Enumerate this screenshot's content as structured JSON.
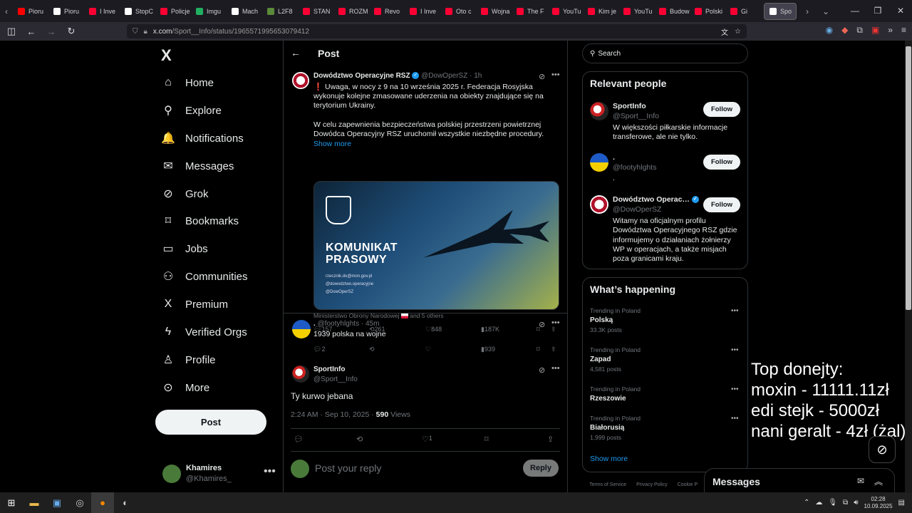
{
  "browser": {
    "tabs": [
      "Pioru",
      "Pioru",
      "I Inve",
      "StopC",
      "Policje",
      "Imgu",
      "Mach",
      "L2F8",
      "STAN",
      "ROZM",
      "Revo",
      "I Inve",
      "Oto c",
      "Wojna",
      "The F",
      "YouTu",
      "Kim je",
      "YouTu",
      "Budow",
      "Polski",
      "Gi",
      "Spo"
    ],
    "tab_colors": [
      "#ff0000",
      "#ffffff",
      "#ff0033",
      "#ffffff",
      "#ff0033",
      "#20b060",
      "#ffffff",
      "#5a8a3a",
      "#ff0033",
      "#ff0033",
      "#ff0033",
      "#ff0033",
      "#ff0033",
      "#ff0033",
      "#ff0033",
      "#ff0033",
      "#ff0033",
      "#ff0033",
      "#ff0033",
      "#ff0033",
      "#ff0033",
      "#ffffff"
    ],
    "url_host": "x.com",
    "url_path": "/Sport__Info/status/1965571995653079412"
  },
  "nav": {
    "logo": "X",
    "items": [
      {
        "label": "Home",
        "icon": "⌂"
      },
      {
        "label": "Explore",
        "icon": "⚲"
      },
      {
        "label": "Notifications",
        "icon": "🔔"
      },
      {
        "label": "Messages",
        "icon": "✉"
      },
      {
        "label": "Grok",
        "icon": "⊘"
      },
      {
        "label": "Bookmarks",
        "icon": "⌑"
      },
      {
        "label": "Jobs",
        "icon": "▭"
      },
      {
        "label": "Communities",
        "icon": "⚇"
      },
      {
        "label": "Premium",
        "icon": "X"
      },
      {
        "label": "Verified Orgs",
        "icon": "ϟ"
      },
      {
        "label": "Profile",
        "icon": "♙"
      },
      {
        "label": "More",
        "icon": "⊙"
      }
    ],
    "post_button": "Post",
    "account": {
      "name": "Khamires",
      "handle": "@Khamires_"
    }
  },
  "header": {
    "title": "Post"
  },
  "quoted_tweet": {
    "name": "Dowództwo Operacyjne RSZ",
    "handle": "@DowOperSZ",
    "time": "· 1h",
    "text1": "❗ Uwaga, w nocy z 9 na 10 września 2025 r. Federacja Rosyjska wykonuje kolejne zmasowane uderzenia na obiekty znajdujące się na terytorium Ukrainy.",
    "text2": "W celu zapewnienia bezpieczeństwa polskiej przestrzeni powietrznej Dowódca Operacyjny RSZ uruchomił wszystkie niezbędne procedury.",
    "show_more": "Show more",
    "image": {
      "title_line1": "KOMUNIKAT",
      "title_line2": "PRASOWY",
      "contact1": "rzecznik.do@mon.gov.pl",
      "contact2": "@dowodztwo.operacyjne",
      "contact3": "@DowOperSZ"
    },
    "tagged": "Ministerstwo Obrony Narodowej",
    "tagged_more": "and 5 others",
    "replies": "157",
    "reposts": "261",
    "likes": "848",
    "views": "187K"
  },
  "reply1": {
    "name": ".",
    "handle": "@footyhlghts",
    "time": "· 45m",
    "text": "1939 polska na wojne",
    "replies": "2",
    "views": "939"
  },
  "main_tweet": {
    "name": "SportInfo",
    "handle": "@Sport__Info",
    "text": "Ty kurwo jebana",
    "timestamp": "2:24 AM · Sep 10, 2025 ·",
    "views": "590",
    "views_label": "Views",
    "likes": "1"
  },
  "reply_box": {
    "placeholder": "Post your reply",
    "button": "Reply"
  },
  "search": {
    "placeholder": "Search"
  },
  "relevant": {
    "title": "Relevant people",
    "people": [
      {
        "name": "SportInfo",
        "handle": "@Sport__Info",
        "bio": "W większości piłkarskie informacje transferowe, ale nie tylko.",
        "follow": "Follow"
      },
      {
        "name": ".",
        "handle": "@footyhlghts",
        "bio": ".",
        "follow": "Follow"
      },
      {
        "name": "Dowództwo Operac…",
        "handle": "@DowOperSZ",
        "bio": "Witamy na oficjalnym profilu Dowództwa Operacyjnego RSZ gdzie informujemy o działaniach żołnierzy WP w operacjach, a także misjach poza granicami kraju.",
        "follow": "Follow"
      }
    ]
  },
  "happening": {
    "title": "What’s happening",
    "trends": [
      {
        "context": "Trending in Poland",
        "name": "Polską",
        "posts": "33.3K posts"
      },
      {
        "context": "Trending in Poland",
        "name": "Zapad",
        "posts": "4,581 posts"
      },
      {
        "context": "Trending in Poland",
        "name": "Rzeszowie",
        "posts": ""
      },
      {
        "context": "Trending in Poland",
        "name": "Białorusią",
        "posts": "1,999 posts"
      }
    ],
    "show_more": "Show more"
  },
  "footer": [
    "Terms of Service",
    "Privacy Policy",
    "Cookie P"
  ],
  "overlay": {
    "line1": "Top donejty:",
    "line2": "moxin - 11111.11zł",
    "line3": "edi stejk - 5000zł",
    "line4": "nani geralt - 4zł (żal)"
  },
  "messages_dock": {
    "title": "Messages"
  },
  "taskbar": {
    "time": "02:28",
    "date": "10.09.2025"
  }
}
